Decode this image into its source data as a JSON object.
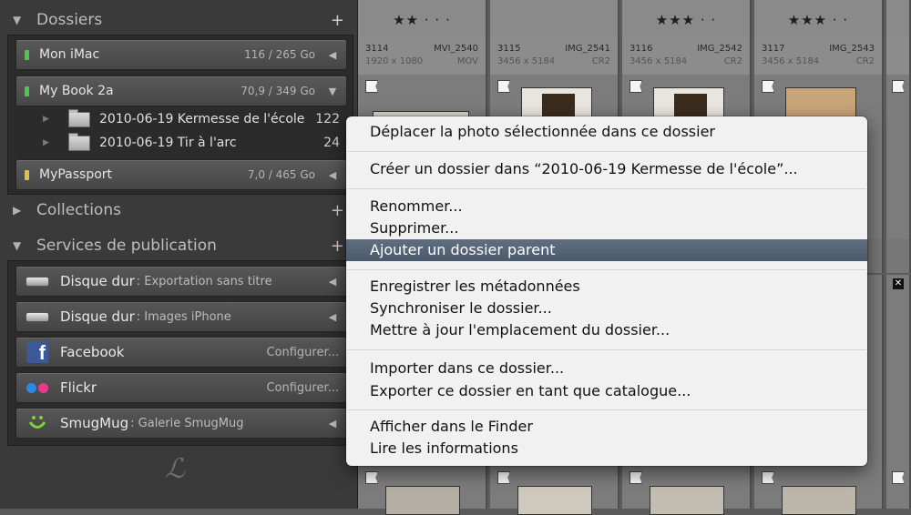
{
  "left_panel": {
    "folders_section": {
      "title": "Dossiers",
      "plus": "+"
    },
    "volumes": [
      {
        "name": "Mon iMac",
        "size": "116 / 265 Go",
        "led": "#4cc74c",
        "arrow": "◀"
      },
      {
        "name": "My Book 2a",
        "size": "70,9 / 349 Go",
        "led": "#4cc74c",
        "arrow": "▼"
      },
      {
        "name": "MyPassport",
        "size": "7,0 / 465 Go",
        "led": "#e0c040",
        "arrow": "◀"
      }
    ],
    "subfolders": [
      {
        "name": "2010-06-19 Kermesse de l'école",
        "count": "122"
      },
      {
        "name": "2010-06-19 Tir à l'arc",
        "count": "24"
      }
    ],
    "collections_section": {
      "title": "Collections",
      "plus": "+"
    },
    "publish_section": {
      "title": "Services de publication",
      "plus": "+"
    },
    "services": [
      {
        "name": "Disque dur",
        "sub": ": Exportation sans titre",
        "config": "",
        "icon": "hard-drive-icon"
      },
      {
        "name": "Disque dur",
        "sub": ": Images iPhone",
        "config": "",
        "icon": "hard-drive-icon"
      },
      {
        "name": "Facebook",
        "sub": "",
        "config": "Configurer...",
        "icon": "facebook-icon"
      },
      {
        "name": "Flickr",
        "sub": "",
        "config": "Configurer...",
        "icon": "flickr-icon"
      },
      {
        "name": "SmugMug",
        "sub": ": Galerie SmugMug",
        "config": "",
        "icon": "smugmug-icon"
      }
    ]
  },
  "grid": {
    "cells": [
      {
        "stars": "★★ · · ·",
        "num": "3114",
        "file": "MVI_2540",
        "dims": "1920 x 1080",
        "type": "MOV"
      },
      {
        "stars": "",
        "num": "3115",
        "file": "IMG_2541",
        "dims": "3456 x 5184",
        "type": "CR2"
      },
      {
        "stars": "★★★ · ·",
        "num": "3116",
        "file": "IMG_2542",
        "dims": "3456 x 5184",
        "type": "CR2"
      },
      {
        "stars": "★★★ · ·",
        "num": "3117",
        "file": "IMG_2543",
        "dims": "3456 x 5184",
        "type": "CR2"
      }
    ]
  },
  "context_menu": {
    "items": [
      "Déplacer la photo sélectionnée dans ce dossier",
      "Créer un dossier dans “2010-06-19 Kermesse de l'école”...",
      "Renommer...",
      "Supprimer...",
      "Ajouter un dossier parent",
      "Enregistrer les métadonnées",
      "Synchroniser le dossier...",
      "Mettre à jour l'emplacement du dossier...",
      "Importer dans ce dossier...",
      "Exporter ce dossier en tant que catalogue...",
      "Afficher dans le Finder",
      "Lire les informations"
    ],
    "selected_item": "Ajouter un dossier parent"
  }
}
